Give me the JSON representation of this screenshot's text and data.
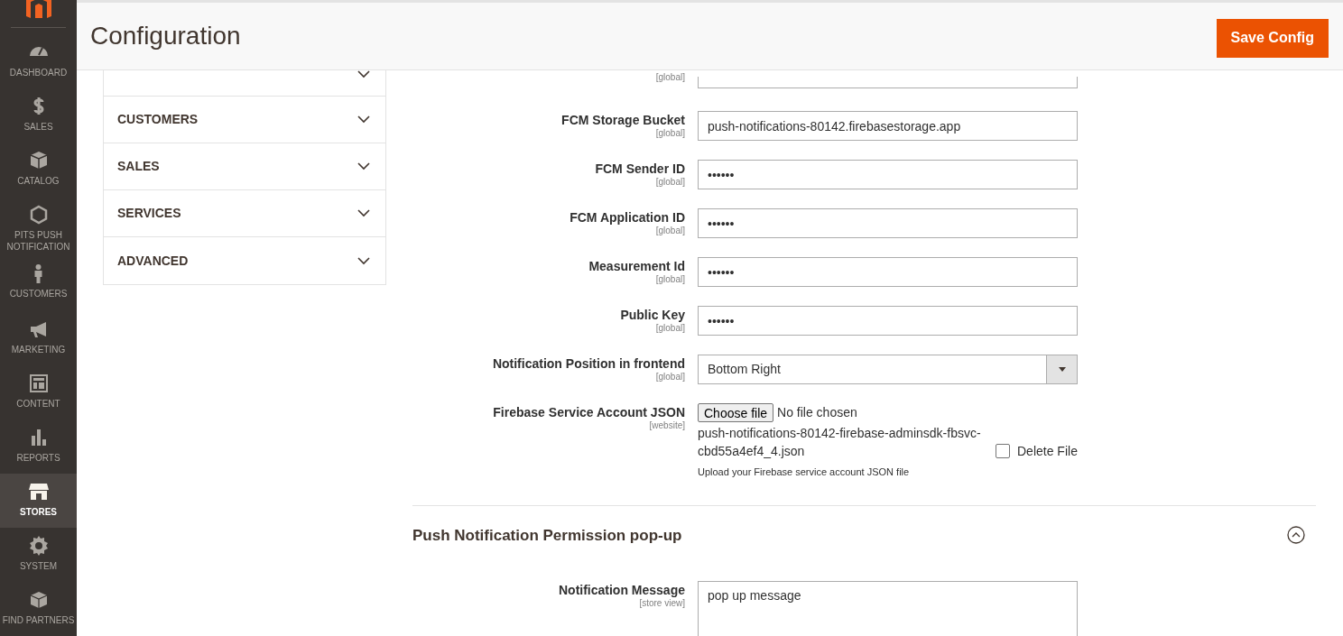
{
  "sidebar": {
    "items": [
      {
        "kind": "dashboard",
        "label": "DASHBOARD",
        "selected": false
      },
      {
        "kind": "sales",
        "label": "SALES",
        "selected": false
      },
      {
        "kind": "catalog",
        "label": "CATALOG",
        "selected": false
      },
      {
        "kind": "hexagon",
        "label": "PITS PUSH NOTIFICATION",
        "selected": false
      },
      {
        "kind": "customers",
        "label": "CUSTOMERS",
        "selected": false
      },
      {
        "kind": "marketing",
        "label": "MARKETING",
        "selected": false
      },
      {
        "kind": "content",
        "label": "CONTENT",
        "selected": false
      },
      {
        "kind": "reports",
        "label": "REPORTS",
        "selected": false
      },
      {
        "kind": "stores",
        "label": "STORES",
        "selected": true
      },
      {
        "kind": "system",
        "label": "SYSTEM",
        "selected": false
      },
      {
        "kind": "partners",
        "label": "FIND PARTNERS",
        "selected": false
      }
    ]
  },
  "page_title": "Configuration",
  "save_button": "Save Config",
  "config_tabs": [
    {
      "expanded": false
    },
    {
      "label": "CUSTOMERS",
      "expanded": false
    },
    {
      "label": "SALES",
      "expanded": false
    },
    {
      "label": "SERVICES",
      "expanded": false
    },
    {
      "label": "ADVANCED",
      "expanded": false
    }
  ],
  "fields": [
    {
      "kind": "text",
      "scope": "[global]"
    },
    {
      "kind": "text",
      "label": "FCM Storage Bucket",
      "scope": "[global]",
      "value": "push-notifications-80142.firebasestorage.app"
    },
    {
      "kind": "text",
      "label": "FCM Sender ID",
      "scope": "[global]",
      "value": "••••••"
    },
    {
      "kind": "text",
      "label": "FCM Application ID",
      "scope": "[global]",
      "value": "••••••"
    },
    {
      "kind": "text",
      "label": "Measurement Id",
      "scope": "[global]",
      "value": "••••••"
    },
    {
      "kind": "text",
      "label": "Public Key",
      "scope": "[global]",
      "value": "••••••"
    },
    {
      "kind": "select",
      "label": "Notification Position in frontend",
      "scope": "[global]",
      "value": "Bottom Right"
    },
    {
      "kind": "file",
      "label": "Firebase Service Account JSON",
      "scope": "[website]",
      "button": "Choose file",
      "status": "No file chosen",
      "filename": "push-notifications-80142-firebase-adminsdk-fbsvc-cbd55a4ef4_4.json",
      "delete_label": "Delete File",
      "delete_checked": false,
      "note": "Upload your Firebase service account JSON file"
    }
  ],
  "section": {
    "title": "Push Notification Permission pop-up",
    "expanded": true,
    "fields": [
      {
        "kind": "textarea",
        "label": "Notification Message",
        "scope": "[store view]",
        "value": "pop up message"
      }
    ]
  }
}
